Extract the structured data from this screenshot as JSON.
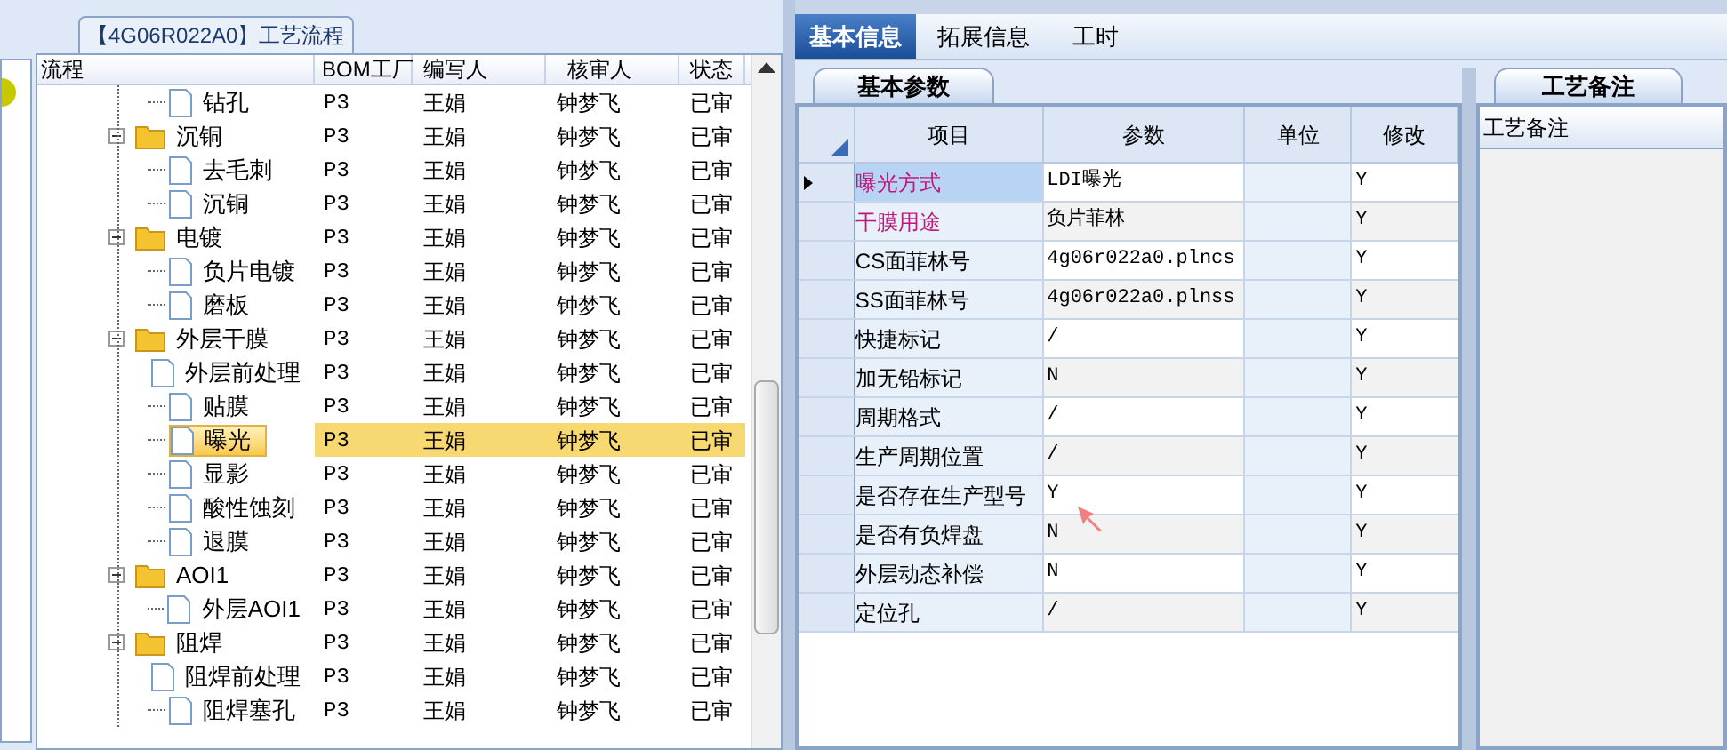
{
  "flow_panel": {
    "title": "【4G06R022A0】工艺流程",
    "columns": [
      "流程",
      "BOM工厂",
      "编写人",
      "核审人",
      "状态"
    ],
    "tree": [
      {
        "kind": "file",
        "label": "钻孔",
        "selected": false,
        "cells": [
          "P3",
          "王娟",
          "钟梦飞",
          "已审"
        ]
      },
      {
        "kind": "folder",
        "label": "沉铜",
        "expanded": true,
        "selected": false,
        "cells": [
          "P3",
          "王娟",
          "钟梦飞",
          "已审"
        ],
        "children": [
          {
            "kind": "file",
            "label": "去毛刺",
            "selected": false,
            "cells": [
              "P3",
              "王娟",
              "钟梦飞",
              "已审"
            ]
          },
          {
            "kind": "file",
            "label": "沉铜",
            "selected": false,
            "cells": [
              "P3",
              "王娟",
              "钟梦飞",
              "已审"
            ]
          }
        ]
      },
      {
        "kind": "folder",
        "label": "电镀",
        "expanded": true,
        "selected": false,
        "cells": [
          "P3",
          "王娟",
          "钟梦飞",
          "已审"
        ],
        "children": [
          {
            "kind": "file",
            "label": "负片电镀",
            "selected": false,
            "cells": [
              "P3",
              "王娟",
              "钟梦飞",
              "已审"
            ]
          },
          {
            "kind": "file",
            "label": "磨板",
            "selected": false,
            "cells": [
              "P3",
              "王娟",
              "钟梦飞",
              "已审"
            ]
          }
        ]
      },
      {
        "kind": "folder",
        "label": "外层干膜",
        "expanded": true,
        "selected": false,
        "cells": [
          "P3",
          "王娟",
          "钟梦飞",
          "已审"
        ],
        "children": [
          {
            "kind": "file",
            "label": "外层前处理",
            "selected": false,
            "cells": [
              "P3",
              "王娟",
              "钟梦飞",
              "已审"
            ]
          },
          {
            "kind": "file",
            "label": "贴膜",
            "selected": false,
            "cells": [
              "P3",
              "王娟",
              "钟梦飞",
              "已审"
            ]
          },
          {
            "kind": "file",
            "label": "曝光",
            "selected": true,
            "cells": [
              "P3",
              "王娟",
              "钟梦飞",
              "已审"
            ]
          },
          {
            "kind": "file",
            "label": "显影",
            "selected": false,
            "cells": [
              "P3",
              "王娟",
              "钟梦飞",
              "已审"
            ]
          },
          {
            "kind": "file",
            "label": "酸性蚀刻",
            "selected": false,
            "cells": [
              "P3",
              "王娟",
              "钟梦飞",
              "已审"
            ]
          },
          {
            "kind": "file",
            "label": "退膜",
            "selected": false,
            "cells": [
              "P3",
              "王娟",
              "钟梦飞",
              "已审"
            ]
          }
        ]
      },
      {
        "kind": "folder",
        "label": "AOI1",
        "expanded": true,
        "selected": false,
        "cells": [
          "P3",
          "王娟",
          "钟梦飞",
          "已审"
        ],
        "children": [
          {
            "kind": "file",
            "label": "外层AOI1",
            "selected": false,
            "cells": [
              "P3",
              "王娟",
              "钟梦飞",
              "已审"
            ]
          }
        ]
      },
      {
        "kind": "folder",
        "label": "阻焊",
        "expanded": true,
        "selected": false,
        "cells": [
          "P3",
          "王娟",
          "钟梦飞",
          "已审"
        ],
        "children": [
          {
            "kind": "file",
            "label": "阻焊前处理",
            "selected": false,
            "cells": [
              "P3",
              "王娟",
              "钟梦飞",
              "已审"
            ]
          },
          {
            "kind": "file",
            "label": "阻焊塞孔",
            "selected": false,
            "cells": [
              "P3",
              "王娟",
              "钟梦飞",
              "已审"
            ]
          }
        ]
      }
    ]
  },
  "tabs": [
    {
      "label": "基本信息",
      "selected": true
    },
    {
      "label": "拓展信息",
      "selected": false
    },
    {
      "label": "工时",
      "selected": false
    }
  ],
  "sub_tab": "基本参数",
  "params": {
    "columns": [
      "项目",
      "参数",
      "单位",
      "修改"
    ],
    "rows": [
      {
        "item": "曝光方式",
        "value": "LDI曝光",
        "modify": "Y",
        "color": "#c0187a",
        "selected": true
      },
      {
        "item": "干膜用途",
        "value": "负片菲林",
        "modify": "Y",
        "color": "#c0187a",
        "selected": false
      },
      {
        "item": "CS面菲林号",
        "value": "4g06r022a0.plncs",
        "modify": "Y",
        "color": "#000000",
        "selected": false
      },
      {
        "item": "SS面菲林号",
        "value": "4g06r022a0.plnss",
        "modify": "Y",
        "color": "#000000",
        "selected": false
      },
      {
        "item": "快捷标记",
        "value": "/",
        "modify": "Y",
        "color": "#000000",
        "selected": false
      },
      {
        "item": "加无铅标记",
        "value": "N",
        "modify": "Y",
        "color": "#000000",
        "selected": false
      },
      {
        "item": "周期格式",
        "value": "/",
        "modify": "Y",
        "color": "#000000",
        "selected": false
      },
      {
        "item": "生产周期位置",
        "value": "/",
        "modify": "Y",
        "color": "#000000",
        "selected": false
      },
      {
        "item": "是否存在生产型号",
        "value": "Y",
        "modify": "Y",
        "color": "#000000",
        "selected": false
      },
      {
        "item": "是否有负焊盘",
        "value": "N",
        "modify": "Y",
        "color": "#000000",
        "selected": false
      },
      {
        "item": "外层动态补偿",
        "value": "N",
        "modify": "Y",
        "color": "#000000",
        "selected": false
      },
      {
        "item": "定位孔",
        "value": "/",
        "modify": "Y",
        "color": "#000000",
        "selected": false
      }
    ]
  },
  "notes": {
    "tab": "工艺备注",
    "header": "工艺备注"
  }
}
